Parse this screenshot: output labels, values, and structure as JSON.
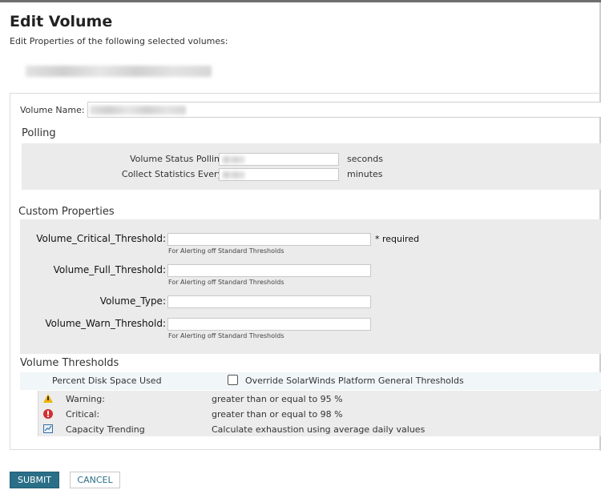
{
  "header": {
    "title": "Edit Volume",
    "subtitle": "Edit Properties of the following selected volumes:"
  },
  "volume_name": {
    "label": "Volume Name:"
  },
  "polling": {
    "title": "Polling",
    "status_polling_label": "Volume Status Polling",
    "status_polling_unit": "seconds",
    "collect_stats_label": "Collect Statistics Every:",
    "collect_stats_unit": "minutes"
  },
  "custom_properties": {
    "title": "Custom Properties",
    "hint": "For Alerting off Standard Thresholds",
    "required_note": "* required",
    "fields": [
      {
        "label": "Volume_Critical_Threshold:"
      },
      {
        "label": "Volume_Full_Threshold:"
      },
      {
        "label": "Volume_Type:"
      },
      {
        "label": "Volume_Warn_Threshold:"
      }
    ]
  },
  "thresholds": {
    "title": "Volume Thresholds",
    "metric_label": "Percent Disk Space Used",
    "override_label": "Override SolarWinds Platform General Thresholds",
    "rows": [
      {
        "icon": "warning-icon",
        "name": "Warning:",
        "value": "greater than or equal to 95 %"
      },
      {
        "icon": "critical-icon",
        "name": "Critical:",
        "value": "greater than or equal to 98 %"
      },
      {
        "icon": "capacity-trend-icon",
        "name": "Capacity Trending",
        "value": "Calculate exhaustion using average daily values"
      }
    ]
  },
  "buttons": {
    "submit": "SUBMIT",
    "cancel": "CANCEL"
  },
  "colors": {
    "primary": "#2a6f87",
    "warning": "#f0b400",
    "critical": "#d32f2f",
    "panel": "#ebebeb"
  }
}
